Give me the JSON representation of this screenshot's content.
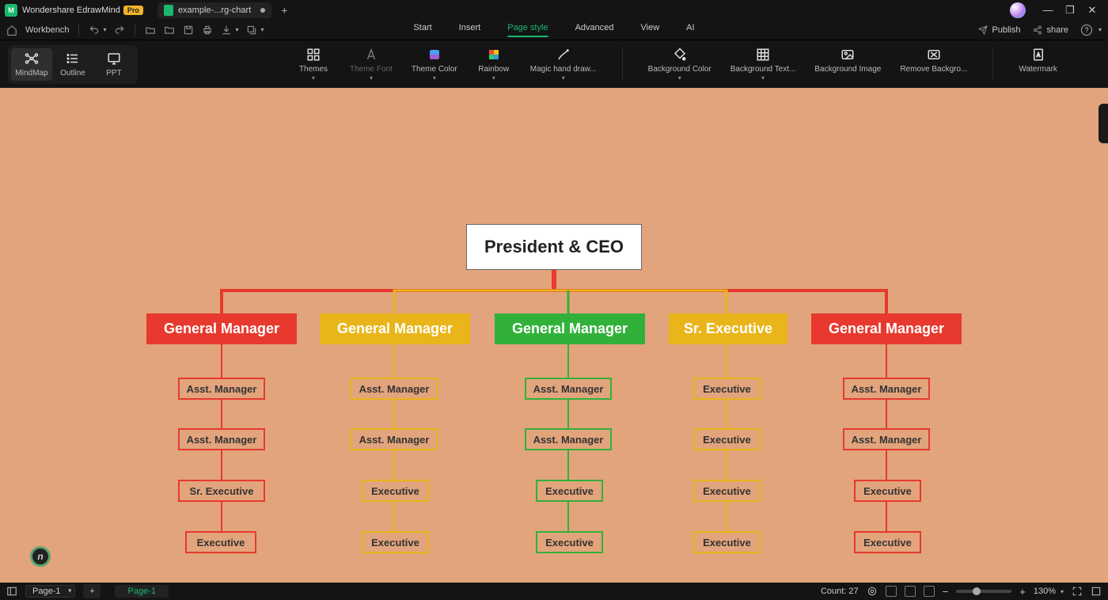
{
  "titlebar": {
    "app_name": "Wondershare EdrawMind",
    "pro_badge": "Pro",
    "doc_tab": "example-...rg-chart"
  },
  "toolbar1": {
    "workbench": "Workbench"
  },
  "menus": {
    "start": "Start",
    "insert": "Insert",
    "page_style": "Page style",
    "advanced": "Advanced",
    "view": "View",
    "ai": "AI"
  },
  "toolbar_right": {
    "publish": "Publish",
    "share": "share"
  },
  "view_modes": {
    "mindmap": "MindMap",
    "outline": "Outline",
    "ppt": "PPT"
  },
  "ribbon": {
    "themes": "Themes",
    "theme_font": "Theme Font",
    "theme_color": "Theme Color",
    "rainbow": "Rainbow",
    "magic": "Magic hand draw...",
    "bg_color": "Background Color",
    "bg_texture": "Background Text...",
    "bg_image": "Background Image",
    "remove_bg": "Remove Backgro...",
    "watermark": "Watermark"
  },
  "chart_data": {
    "type": "org-tree",
    "root": {
      "label": "President & CEO"
    },
    "branches": [
      {
        "label": "General Manager",
        "color": "#e7392e",
        "children": [
          "Asst. Manager",
          "Asst. Manager",
          "Sr. Executive",
          "Executive"
        ]
      },
      {
        "label": "General Manager",
        "color": "#e9b51a",
        "children": [
          "Asst. Manager",
          "Asst. Manager",
          "Executive",
          "Executive"
        ]
      },
      {
        "label": "General Manager",
        "color": "#32b13a",
        "children": [
          "Asst. Manager",
          "Asst. Manager",
          "Executive",
          "Executive"
        ]
      },
      {
        "label": "Sr. Executive",
        "color": "#e9b51a",
        "children": [
          "Executive",
          "Executive",
          "Executive",
          "Executive"
        ]
      },
      {
        "label": "General Manager",
        "color": "#e7392e",
        "children": [
          "Asst. Manager",
          "Asst. Manager",
          "Executive",
          "Executive"
        ]
      }
    ]
  },
  "status": {
    "page_select": "Page-1",
    "page_tab": "Page-1",
    "count": "Count: 27",
    "zoom": "130%"
  }
}
